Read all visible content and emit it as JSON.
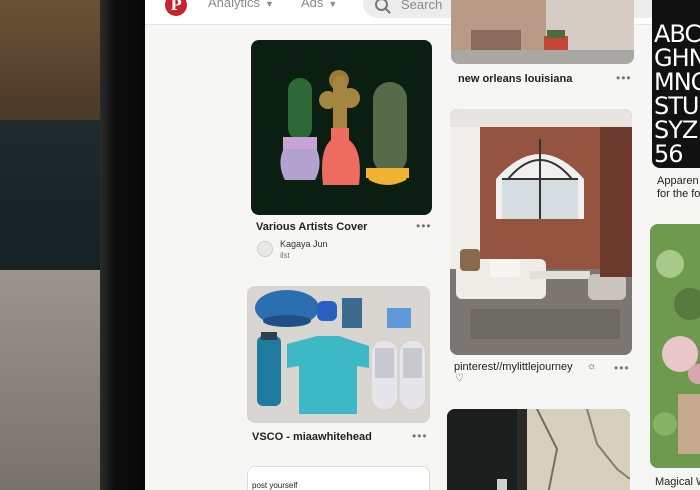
{
  "header": {
    "logo_letter": "P",
    "nav": [
      {
        "label": "Analytics"
      },
      {
        "label": "Ads"
      }
    ],
    "search_placeholder": "Search"
  },
  "pins": [
    {
      "title": "Various Artists Cover",
      "author": "Kagaya Jun",
      "author_sub": "ilst"
    },
    {
      "title": "VSCO - miaawhitehead"
    },
    {
      "caption": "post yourself"
    },
    {
      "title": "new orleans louisiana"
    },
    {
      "title": "pinterest//mylittlejourney"
    },
    {
      "title_lines": [
        "Apparen",
        "for the fo"
      ]
    },
    {
      "title": "Magical W"
    }
  ],
  "typography_pin": {
    "rows": [
      "ABC",
      "GHN",
      "MNO",
      "STU",
      "SYZ",
      "56"
    ]
  }
}
